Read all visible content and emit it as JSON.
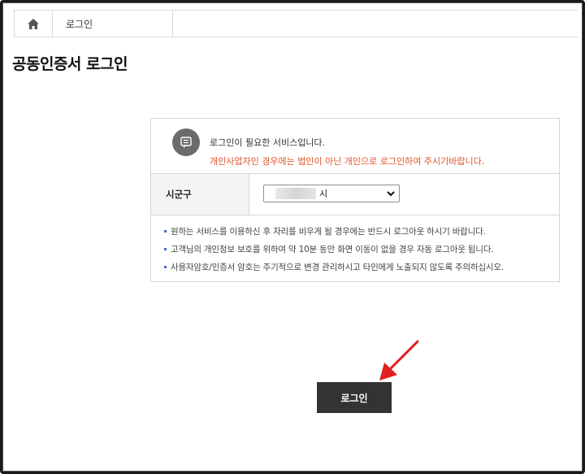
{
  "breadcrumb": {
    "home_icon": "home-icon",
    "current": "로그인"
  },
  "page": {
    "title": "공동인증서 로그인"
  },
  "notice": {
    "icon": "message-icon",
    "line1": "로그인이 필요한 서비스입니다.",
    "line2": "개인사업자인 경우에는 법인이 아닌 개인으로 로그인하여 주시기바랍니다."
  },
  "form": {
    "region_label": "시군구",
    "region_value_suffix": "시"
  },
  "info": {
    "items": [
      "원하는 서비스를 이용하신 후 자리를 비우게 될 경우에는 반드시 로그아웃 하시기 바랍니다.",
      "고객님의 개인정보 보호를 위하여 약 10분 동안 화면 이동이 없을 경우 자동 로그아웃 됩니다.",
      "사용자암호/인증서 암호는 주기적으로 변경 관리하시고 타인에게 노출되지 않도록 주의하십시오."
    ]
  },
  "actions": {
    "login_label": "로그인"
  },
  "colors": {
    "accent_orange": "#e0552a",
    "button_dark": "#333333",
    "bullet_blue": "#3b6fd1",
    "annotation_red": "#e02020"
  }
}
